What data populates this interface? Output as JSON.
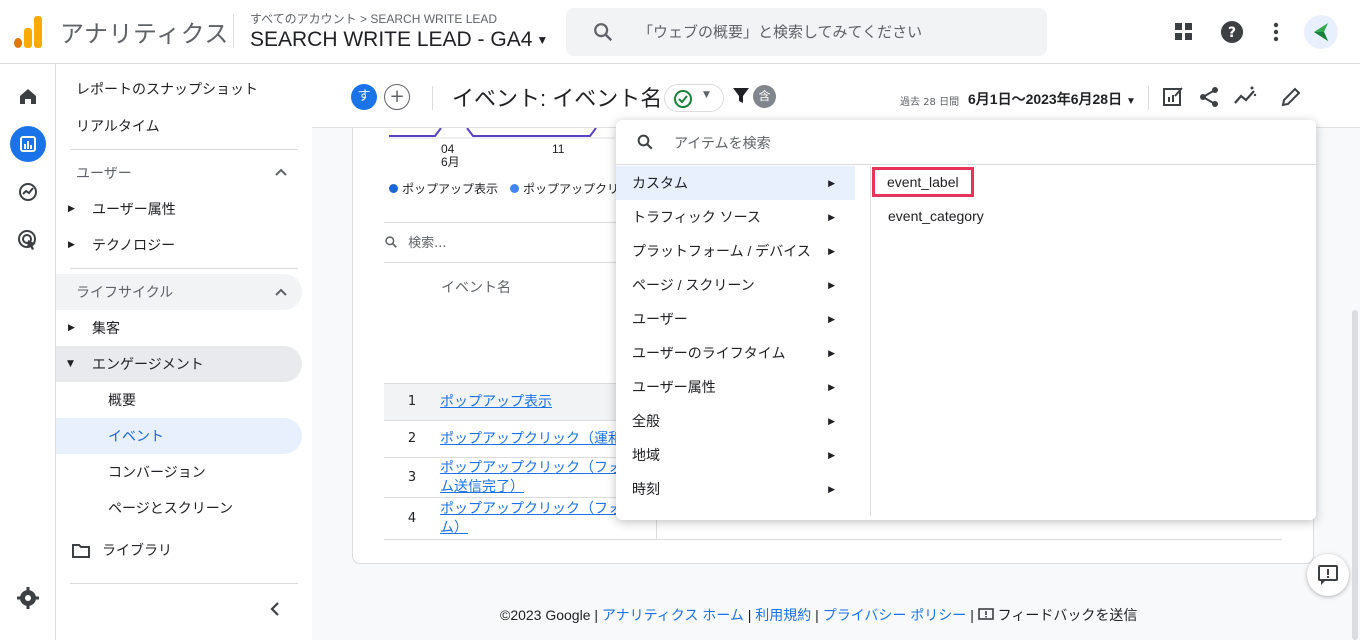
{
  "app": {
    "brand": "アナリティクス",
    "account_crumb": "すべてのアカウント > SEARCH WRITE LEAD",
    "account_name": "SEARCH WRITE LEAD - GA4",
    "search_placeholder": "「ウェブの概要」と検索してみてください",
    "colors": {
      "accent": "#1a73e8",
      "logo_orange": "#f9ab00",
      "logo_dark": "#e37400",
      "highlight": "#e8335b"
    }
  },
  "sidenav": {
    "items": [
      {
        "label": "レポートのスナップショット"
      },
      {
        "label": "リアルタイム"
      }
    ],
    "user_section": "ユーザー",
    "user_items": [
      "ユーザー属性",
      "テクノロジー"
    ],
    "lifecycle_section": "ライフサイクル",
    "lifecycle_items": [
      "集客",
      "エンゲージメント"
    ],
    "engagement_children": [
      "概要",
      "イベント",
      "コンバージョン",
      "ページとスクリーン"
    ],
    "library": "ライブラリ"
  },
  "report": {
    "comparison_chip": "す",
    "add_chip": "+",
    "title": "イベント: イベント名",
    "filter_badge": "含",
    "date_prefix": "過去 28 日間",
    "date_range": "6月1日～2023年6月28日"
  },
  "chart": {
    "tick_1": "04",
    "tick_1_month": "6月",
    "tick_2": "11",
    "legend": [
      "ポップアップ表示",
      "ポップアップクリ"
    ]
  },
  "table": {
    "search_placeholder": "検索...",
    "column_header": "イベント名",
    "rows": [
      {
        "num": "1",
        "name": "ポップアップ表示"
      },
      {
        "num": "2",
        "name": "ポップアップクリック（運和"
      },
      {
        "num": "3",
        "name_line1": "ポップアップクリック（フォ",
        "name_line2": "ム送信完了）"
      },
      {
        "num": "4",
        "name_line1": "ポップアップクリック（フォ",
        "name_line2": "ム）"
      }
    ]
  },
  "dropdown": {
    "search_placeholder": "アイテムを検索",
    "categories": [
      "カスタム",
      "トラフィック ソース",
      "プラットフォーム / デバイス",
      "ページ / スクリーン",
      "ユーザー",
      "ユーザーのライフタイム",
      "ユーザー属性",
      "全般",
      "地域",
      "時刻"
    ],
    "dimensions": [
      "event_label",
      "event_category"
    ]
  },
  "footer": {
    "copyright": "©2023 Google |",
    "link_home": "アナリティクス ホーム",
    "sep1": "|",
    "link_terms": "利用規約",
    "sep2": "|",
    "link_privacy": "プライバシー ポリシー",
    "sep3": "|",
    "feedback": "フィードバックを送信"
  }
}
